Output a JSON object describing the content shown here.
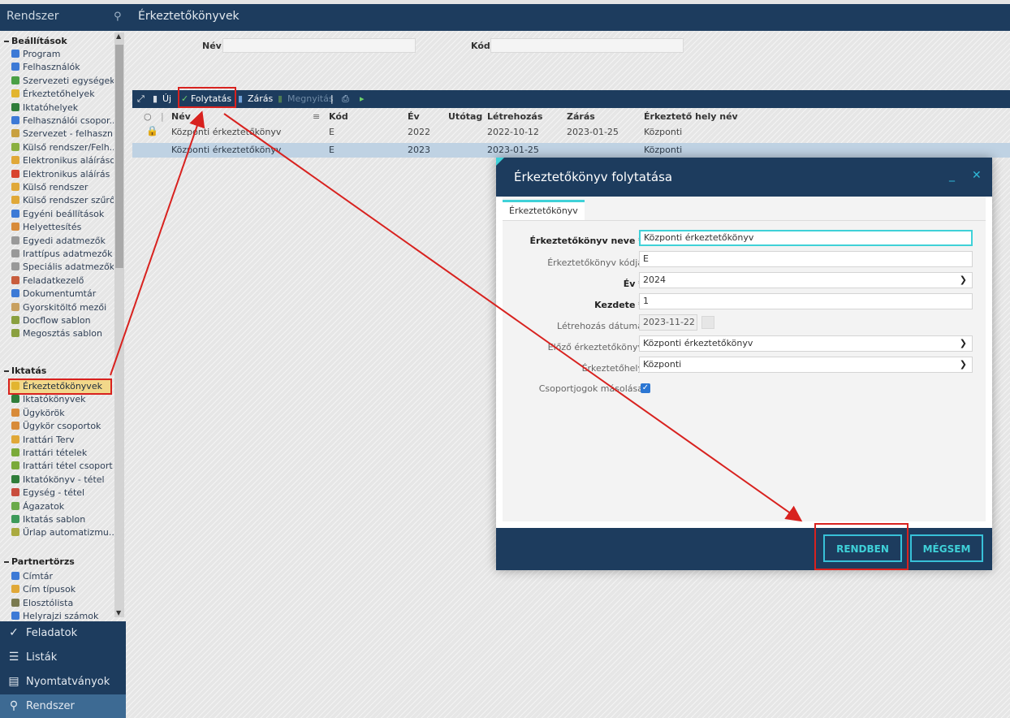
{
  "topbar": {
    "app_title": "Rendszer",
    "page_title": "Érkeztetőkönyvek",
    "search_icon": "search-icon"
  },
  "sidebar": {
    "sections": {
      "beallitasok": "Beállítások",
      "iktatas": "Iktatás",
      "partnertorzs": "Partnertörzs"
    },
    "beallitasok_items": [
      "Program",
      "Felhasználók",
      "Szervezeti egységek",
      "Érkeztetőhelyek",
      "Iktatóhelyek",
      "Felhasználói csopor...",
      "Szervezet - felhaszn...",
      "Külső rendszer/Felh...",
      "Elektronikus aláírások",
      "Elektronikus aláírás ...",
      "Külső rendszer",
      "Külső rendszer szűrők",
      "Egyéni beállítások",
      "Helyettesítés",
      "Egyedi adatmezők",
      "Irattípus adatmezők",
      "Speciális adatmezők",
      "Feladatkezelő",
      "Dokumentumtár",
      "Gyorskitöltő mezői",
      "Docflow sablon",
      "Megosztás sablon"
    ],
    "iktatas_items": [
      "Érkeztetőkönyvek",
      "Iktatókönyvek",
      "Ügykörök",
      "Ügykör csoportok",
      "Irattári Terv",
      "Irattári tételek",
      "Irattári tétel csoport...",
      "Iktatókönyv - tétel",
      "Egység - tétel",
      "Ágazatok",
      "Iktatás sablon",
      "Űrlap automatizmu..."
    ],
    "partner_items": [
      "Címtár",
      "Cím típusok",
      "Elosztólista",
      "Helyrajzi számok"
    ],
    "selected_item": "Érkeztetőkönyvek"
  },
  "bottomnav": [
    "Feladatok",
    "Listák",
    "Nyomtatványok",
    "Rendszer"
  ],
  "filter": {
    "name_label": "Név",
    "code_label": "Kód",
    "name_value": "",
    "code_value": ""
  },
  "toolbar": {
    "new": "Új",
    "continue": "Folytatás",
    "close": "Zárás",
    "open": "Megnyitás"
  },
  "table": {
    "headers": [
      "Név",
      "Kód",
      "Év",
      "Utótag",
      "Létrehozás",
      "Zárás",
      "Érkeztető hely név"
    ],
    "rows": [
      {
        "nev": "Központi érkeztetőkönyv",
        "kod": "E",
        "ev": "2022",
        "utotag": "",
        "letrehozas": "2022-10-12",
        "zaras": "2023-01-25",
        "hely": "Központi",
        "locked": true
      },
      {
        "nev": "Központi érkeztetőkönyv",
        "kod": "E",
        "ev": "2023",
        "utotag": "",
        "letrehozas": "2023-01-25",
        "zaras": "",
        "hely": "Központi",
        "locked": false
      }
    ]
  },
  "dialog": {
    "title": "Érkeztetőkönyv folytatása",
    "tab": "Érkeztetőkönyv",
    "fields": {
      "nev_label": "Érkeztetőkönyv neve *",
      "nev_value": "Központi érkeztetőkönyv",
      "kod_label": "Érkeztetőkönyv kódja",
      "kod_value": "E",
      "ev_label": "Év *",
      "ev_value": "2024",
      "kezdete_label": "Kezdete *",
      "kezdete_value": "1",
      "letrehozas_label": "Létrehozás dátuma",
      "letrehozas_value": "2023-11-22",
      "elozo_label": "Előző érkeztetőkönyv",
      "elozo_value": "Központi érkeztetőkönyv",
      "hely_label": "Érkeztetőhely",
      "hely_value": "Központi",
      "csoport_label": "Csoportjogok másolása",
      "csoport_checked": true
    },
    "ok": "RENDBEN",
    "cancel": "MÉGSEM"
  },
  "colors": {
    "navy": "#1d3c5e",
    "accent": "#3fd1d8",
    "highlight": "#d8221f"
  }
}
